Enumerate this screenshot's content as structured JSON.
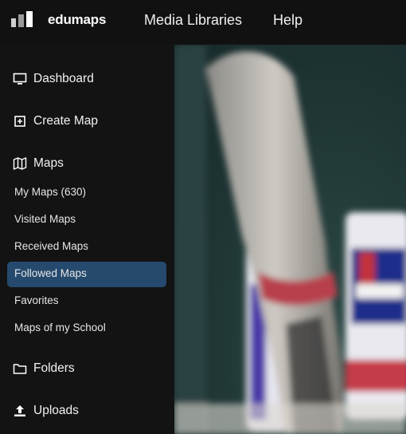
{
  "brand": {
    "name": "edumaps"
  },
  "topnav": {
    "media_libraries": "Media Libraries",
    "help": "Help"
  },
  "sidebar": {
    "dashboard": "Dashboard",
    "create_map": "Create Map",
    "maps": "Maps",
    "maps_items": [
      "My Maps (630)",
      "Visited Maps",
      "Received Maps",
      "Followed Maps",
      "Favorites",
      "Maps of my School"
    ],
    "active_item": "Followed Maps",
    "folders": "Folders",
    "uploads": "Uploads"
  },
  "colors": {
    "active_bg": "#254a6e",
    "background": "#131313"
  },
  "icons": [
    "monitor-icon",
    "plus-square-icon",
    "map-icon",
    "folder-icon",
    "upload-icon"
  ]
}
